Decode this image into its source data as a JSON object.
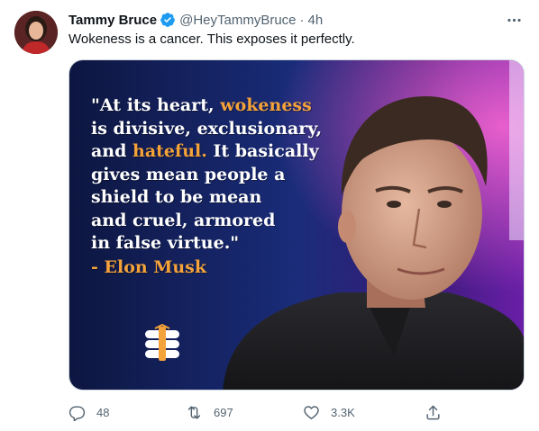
{
  "tweet": {
    "display_name": "Tammy Bruce",
    "handle": "@HeyTammyBruce",
    "separator": "·",
    "time": "4h",
    "text": "Wokeness is a cancer. This exposes it perfectly.",
    "verified": true
  },
  "media": {
    "quote_lines": [
      "\"At its heart, ",
      "wokeness",
      "is divisive, exclusionary,",
      "and ",
      "hateful.",
      " It basically",
      "gives mean people a",
      "shield to be mean",
      "and cruel, armored",
      "in false virtue.\""
    ],
    "attribution": "- Elon Musk",
    "highlight_color": "#f4a23a"
  },
  "actions": {
    "reply_count": "48",
    "retweet_count": "697",
    "like_count": "3.3K"
  },
  "icons": {
    "verified": "verified-badge-icon",
    "more": "more-horizontal-icon",
    "reply": "reply-icon",
    "retweet": "retweet-icon",
    "like": "heart-icon",
    "share": "share-icon",
    "logo": "babylon-bee-logo"
  },
  "colors": {
    "text_primary": "#0f1419",
    "text_secondary": "#536471",
    "verified_blue": "#1d9bf0"
  }
}
